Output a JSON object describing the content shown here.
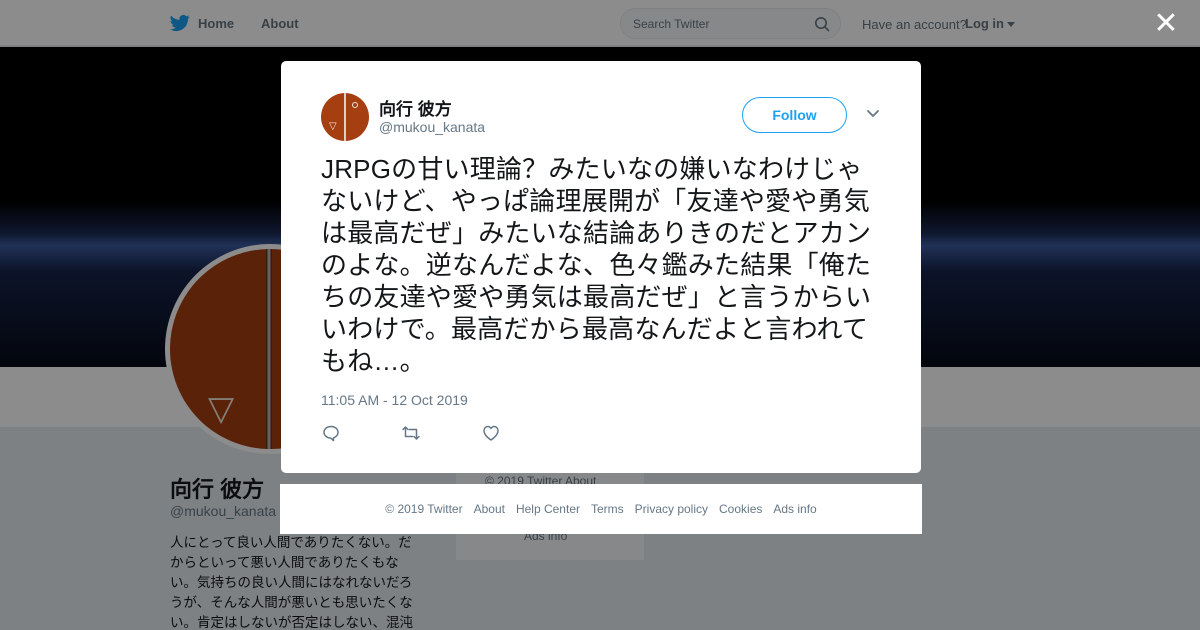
{
  "topbar": {
    "home_label": "Home",
    "about_label": "About",
    "search_placeholder": "Search Twitter",
    "have_account": "Have an account?",
    "login_label": "Log in"
  },
  "profile": {
    "name": "向行 彼方",
    "handle": "@mukou_kanata",
    "bio": "人にとって良い人間でありたくない。だからといって悪い人間でありたくもない。気持ちの良い人間にはなれないだろうが、そんな人間が悪いとも思いたくない。肯定はしないが否定はしない、混沌"
  },
  "side_card": {
    "copyright": "© 2019 Twitter",
    "about": "About",
    "ads": "Ads info"
  },
  "tweet": {
    "author_name": "向行 彼方",
    "author_handle": "@mukou_kanata",
    "follow_label": "Follow",
    "text": "JRPGの甘い理論？みたいなの嫌いなわけじゃないけど、やっぱ論理展開が「友達や愛や勇気は最高だぜ」みたいな結論ありきのだとアカンのよな。逆なんだよな、色々鑑みた結果「俺たちの友達や愛や勇気は最高だぜ」と言うからいいわけで。最高だから最高なんだよと言われてもね…。",
    "timestamp": "11:05 AM - 12 Oct 2019",
    "actions": [
      "reply-icon",
      "retweet-icon",
      "like-icon"
    ]
  },
  "footer": {
    "links": [
      "© 2019 Twitter",
      "About",
      "Help Center",
      "Terms",
      "Privacy policy",
      "Cookies",
      "Ads info"
    ]
  },
  "colors": {
    "twitter_blue": "#1da1f2",
    "text_primary": "#14171a",
    "text_secondary": "#657786",
    "avatar_brown": "#a53e10"
  }
}
